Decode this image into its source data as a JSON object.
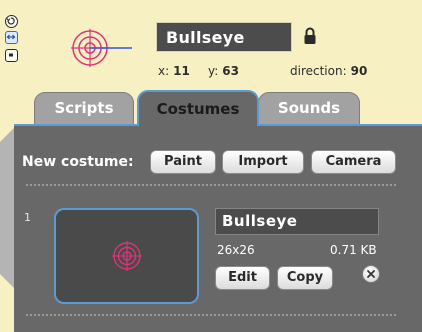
{
  "sprite": {
    "name": "Bullseye",
    "x_label": "x:",
    "x_value": "11",
    "y_label": "y:",
    "y_value": "63",
    "direction_label": "direction:",
    "direction_value": "90",
    "rotation_style": "left-right"
  },
  "tabs": [
    {
      "label": "Scripts",
      "selected": false
    },
    {
      "label": "Costumes",
      "selected": true
    },
    {
      "label": "Sounds",
      "selected": false
    }
  ],
  "costumes_panel": {
    "new_costume_label": "New costume:",
    "paint_label": "Paint",
    "import_label": "Import",
    "camera_label": "Camera"
  },
  "costume": {
    "index": "1",
    "name": "Bullseye",
    "dimensions": "26x26",
    "file_size": "0.71 KB",
    "edit_label": "Edit",
    "copy_label": "Copy"
  },
  "colors": {
    "background": "#f7f0c2",
    "panel": "#686868",
    "accent": "#5b9bd5",
    "bullseye": "#e0337a"
  },
  "icons": {
    "rotate_full": "rotate-full-icon",
    "rotate_left_right": "rotate-left-right-icon",
    "no_rotate": "no-rotate-icon",
    "lock": "lock-icon",
    "delete": "delete-icon"
  }
}
